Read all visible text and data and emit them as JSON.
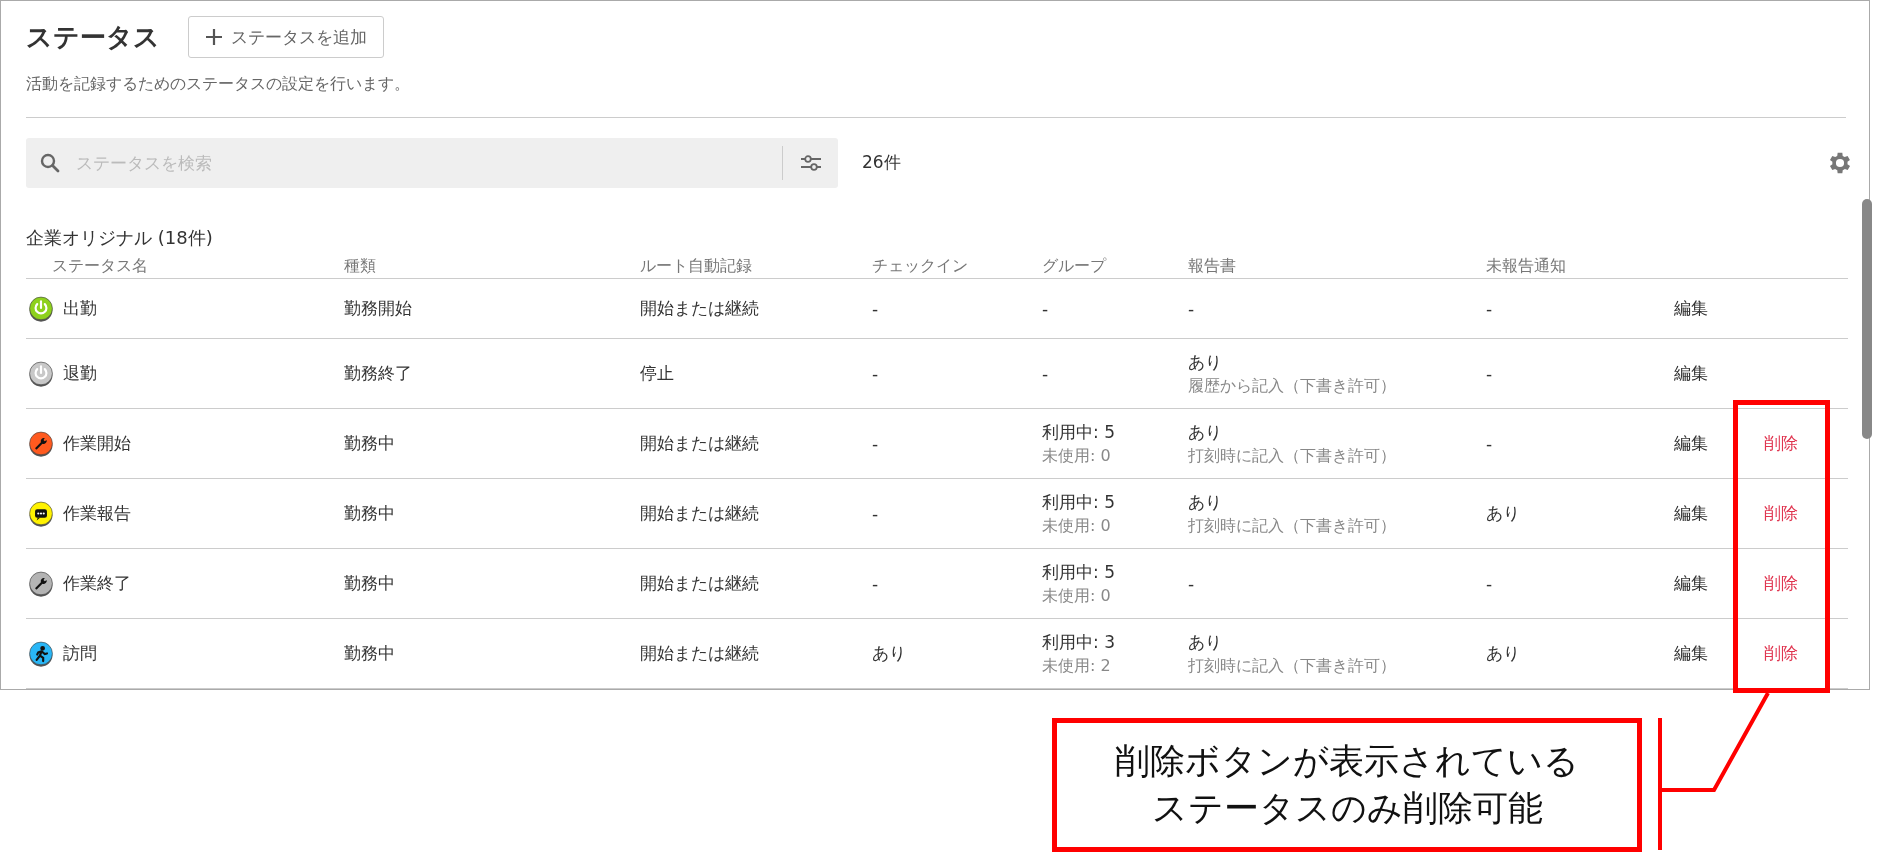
{
  "header": {
    "title": "ステータス",
    "add_button": "ステータスを追加",
    "description": "活動を記録するためのステータスの設定を行います。"
  },
  "search": {
    "placeholder": "ステータスを検索"
  },
  "count": "26件",
  "section": {
    "title": "企業オリジナル (18件)",
    "columns": [
      "ステータス名",
      "種類",
      "ルート自動記録",
      "チェックイン",
      "グループ",
      "報告書",
      "未報告通知"
    ],
    "rows": [
      {
        "kind": "power",
        "color": "#8ed11d",
        "name": "出勤",
        "type": "勤務開始",
        "route": "開始または継続",
        "checkin": "-",
        "group": [
          "-"
        ],
        "report": [
          "-"
        ],
        "notify": "-",
        "edit": "編集"
      },
      {
        "kind": "power",
        "color": "#c8c8c8",
        "name": "退勤",
        "type": "勤務終了",
        "route": "停止",
        "checkin": "-",
        "group": [
          "-"
        ],
        "report": [
          "あり",
          "履歴から記入（下書き許可）"
        ],
        "notify": "-",
        "edit": "編集"
      },
      {
        "kind": "wrench",
        "color": "#ff5a1f",
        "name": "作業開始",
        "type": "勤務中",
        "route": "開始または継続",
        "checkin": "-",
        "group": [
          "利用中: 5",
          "未使用: 0"
        ],
        "report": [
          "あり",
          "打刻時に記入（下書き許可）"
        ],
        "notify": "-",
        "edit": "編集",
        "delete": "削除"
      },
      {
        "kind": "chat",
        "color": "#fff200",
        "name": "作業報告",
        "type": "勤務中",
        "route": "開始または継続",
        "checkin": "-",
        "group": [
          "利用中: 5",
          "未使用: 0"
        ],
        "report": [
          "あり",
          "打刻時に記入（下書き許可）"
        ],
        "notify": "あり",
        "edit": "編集",
        "delete": "削除"
      },
      {
        "kind": "wrench",
        "color": "#b4b4b4",
        "name": "作業終了",
        "type": "勤務中",
        "route": "開始または継続",
        "checkin": "-",
        "group": [
          "利用中: 5",
          "未使用: 0"
        ],
        "report": [
          "-"
        ],
        "notify": "-",
        "edit": "編集",
        "delete": "削除"
      },
      {
        "kind": "walk",
        "color": "#29b6f6",
        "name": "訪問",
        "type": "勤務中",
        "route": "開始または継続",
        "checkin": "あり",
        "group": [
          "利用中: 3",
          "未使用: 2"
        ],
        "report": [
          "あり",
          "打刻時に記入（下書き許可）"
        ],
        "notify": "あり",
        "edit": "編集",
        "delete": "削除"
      }
    ]
  },
  "annotation": {
    "lines": [
      "削除ボタンが表示されている",
      "ステータスのみ削除可能"
    ]
  }
}
